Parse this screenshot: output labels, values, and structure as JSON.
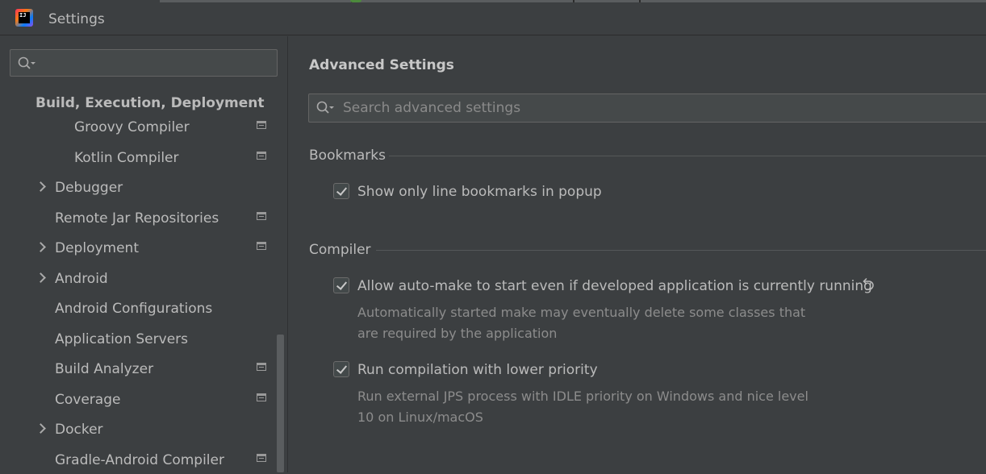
{
  "window": {
    "title": "Settings",
    "logo_text": "IJ"
  },
  "sidebar": {
    "search_placeholder": "",
    "items": [
      {
        "label": "Build, Execution, Deployment",
        "expandable": false,
        "project_icon": false
      },
      {
        "label": "Groovy Compiler",
        "expandable": false,
        "project_icon": true
      },
      {
        "label": "Kotlin Compiler",
        "expandable": false,
        "project_icon": true
      },
      {
        "label": "Debugger",
        "expandable": true,
        "project_icon": false
      },
      {
        "label": "Remote Jar Repositories",
        "expandable": false,
        "project_icon": true
      },
      {
        "label": "Deployment",
        "expandable": true,
        "project_icon": true
      },
      {
        "label": "Android",
        "expandable": true,
        "project_icon": false
      },
      {
        "label": "Android Configurations",
        "expandable": false,
        "project_icon": false
      },
      {
        "label": "Application Servers",
        "expandable": false,
        "project_icon": false
      },
      {
        "label": "Build Analyzer",
        "expandable": false,
        "project_icon": true
      },
      {
        "label": "Coverage",
        "expandable": false,
        "project_icon": true
      },
      {
        "label": "Docker",
        "expandable": true,
        "project_icon": false
      },
      {
        "label": "Gradle-Android Compiler",
        "expandable": false,
        "project_icon": true
      }
    ]
  },
  "main": {
    "title": "Advanced Settings",
    "search_placeholder": "Search advanced settings",
    "sections": [
      {
        "header": "Bookmarks",
        "options": [
          {
            "label": "Show only line bookmarks in popup",
            "checked": true,
            "description": ""
          }
        ]
      },
      {
        "header": "Compiler",
        "options": [
          {
            "label": "Allow auto-make to start even if developed application is currently running",
            "checked": true,
            "modified": true,
            "description_lines": [
              "Automatically started make may eventually delete some classes that",
              "are required by the application"
            ]
          },
          {
            "label": "Run compilation with lower priority",
            "checked": true,
            "description_lines": [
              "Run external JPS process with IDLE priority on Windows and nice level",
              "10 on Linux/macOS"
            ]
          }
        ]
      }
    ]
  },
  "colors": {
    "background": "#3c3f41",
    "text": "#bbbbbb",
    "muted_text": "#8c8c8c",
    "border": "#646464"
  }
}
